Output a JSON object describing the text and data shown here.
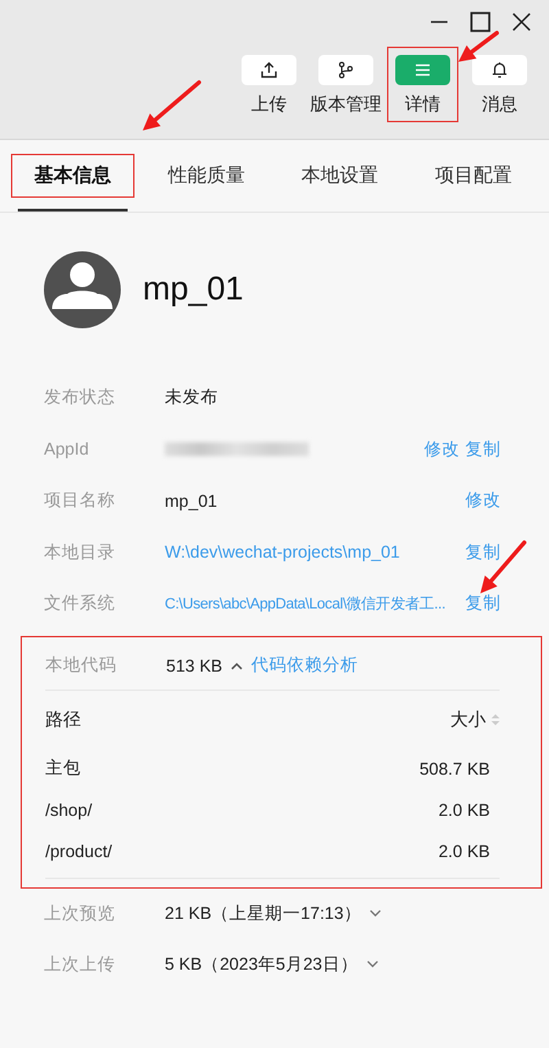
{
  "toolbar": [
    {
      "label": "上传",
      "kind": "upload",
      "selected": false,
      "annotated": false
    },
    {
      "label": "版本管理",
      "kind": "branch",
      "selected": false,
      "annotated": false
    },
    {
      "label": "详情",
      "kind": "menu",
      "selected": true,
      "annotated": true
    },
    {
      "label": "消息",
      "kind": "bell",
      "selected": false,
      "annotated": false
    }
  ],
  "tabs": [
    {
      "label": "基本信息",
      "selected": true,
      "annotated": true
    },
    {
      "label": "性能质量",
      "selected": false,
      "annotated": false
    },
    {
      "label": "本地设置",
      "selected": false,
      "annotated": false
    },
    {
      "label": "项目配置",
      "selected": false,
      "annotated": false
    }
  ],
  "project": {
    "name": "mp_01"
  },
  "fields": [
    {
      "label": "发布状态",
      "kind": "text",
      "value": "未发布"
    },
    {
      "label": "AppId",
      "kind": "redacted",
      "actions": [
        "修改",
        "复制"
      ]
    },
    {
      "label": "项目名称",
      "kind": "text",
      "value": "mp_01",
      "actions": [
        "修改"
      ]
    },
    {
      "label": "本地目录",
      "kind": "link",
      "value": "W:\\dev\\wechat-projects\\mp_01",
      "actions": [
        "复制"
      ]
    },
    {
      "label": "文件系统",
      "kind": "link",
      "value": "C:\\Users\\abc\\AppData\\Local\\微信开发者工...",
      "actions": [
        "复制"
      ]
    }
  ],
  "code": {
    "label": "本地代码",
    "value": "513 KB",
    "expanded": true,
    "link": "代码依赖分析",
    "annotated": true,
    "columns": [
      "路径",
      "大小"
    ],
    "rows": [
      {
        "path": "主包",
        "size": "508.7 KB"
      },
      {
        "path": "/shop/",
        "size": "2.0 KB"
      },
      {
        "path": "/product/",
        "size": "2.0 KB"
      }
    ]
  },
  "history": [
    {
      "label": "上次预览",
      "value": "21 KB（上星期一17:13）",
      "expanded": false
    },
    {
      "label": "上次上传",
      "value": "5 KB（2023年5月23日）",
      "expanded": false
    }
  ]
}
